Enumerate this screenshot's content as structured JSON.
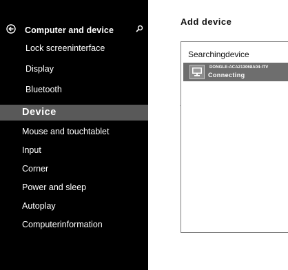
{
  "sidebar": {
    "header_title": "Computer and device",
    "items": [
      {
        "label": "Lock screeninterface",
        "selected": false,
        "sub": true
      },
      {
        "label": "Display",
        "selected": false,
        "sub": true
      },
      {
        "label": "Bluetooth",
        "selected": false,
        "sub": true
      },
      {
        "label": "Device",
        "selected": true,
        "sub": false
      },
      {
        "label": "Mouse and touchtablet",
        "selected": false,
        "sub": false
      },
      {
        "label": "Input",
        "selected": false,
        "sub": false
      },
      {
        "label": "Corner",
        "selected": false,
        "sub": false
      },
      {
        "label": "Power and sleep",
        "selected": false,
        "sub": false
      },
      {
        "label": "Autoplay",
        "selected": false,
        "sub": false
      },
      {
        "label": "Computerinformation",
        "selected": false,
        "sub": false
      }
    ]
  },
  "main": {
    "title": "Add device",
    "dialog": {
      "title": "Searchingdevice",
      "devices": [
        {
          "name": "DONGLE-ACA213068A04-ITV",
          "status": "Connecting",
          "icon": "monitor-icon"
        }
      ]
    }
  },
  "colors": {
    "sidebar_bg": "#000000",
    "selected_bg": "#595959",
    "device_row_bg": "#6e6e6e"
  }
}
